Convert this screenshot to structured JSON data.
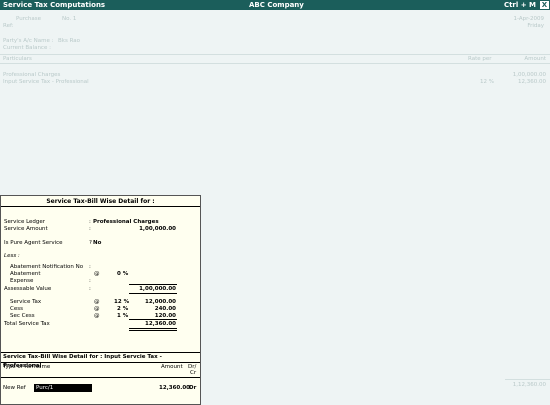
{
  "window": {
    "title": "Service Tax Computations",
    "company": "ABC Company",
    "shortcut": "Ctrl + M",
    "close_glyph": "X"
  },
  "background": {
    "voucher_type": "Purchase",
    "voucher_no": "No. 1",
    "date": "1-Apr-2009",
    "day": "Friday",
    "ref": "Ref:",
    "party_label": "Party's A/c Name :",
    "party_value": "Bks Rao",
    "balance_label": "Current Balance :",
    "col_particulars": "Particulars",
    "col_rate": "Rate  per",
    "col_amount": "Amount",
    "items": [
      {
        "name": "Professional Charges",
        "rate": "",
        "amount": "1,00,000.00"
      },
      {
        "name": "Input Service Tax - Professional",
        "rate": "12  %",
        "amount": "12,360.00"
      }
    ],
    "total": "1,12,360.00"
  },
  "popup": {
    "title": "Service Tax-Bill Wise Detail for :",
    "service_ledger_label": "Service Ledger",
    "service_ledger_value": "Professional Charges",
    "service_amount_label": "Service Amount",
    "service_amount_value": "1,00,000.00",
    "pure_agent_label": "Is Pure Agent Service",
    "pure_agent_q": "?",
    "pure_agent_value": "No",
    "less_label": "Less :",
    "abatement_notification_label": "Abatement Notification No",
    "abatement_label": "Abatement",
    "abatement_at": "@",
    "abatement_pct": "0  %",
    "expense_label": "Expense",
    "assessable_label": "Assessable Value",
    "assessable_value": "1,00,000.00",
    "service_tax_label": "Service Tax",
    "service_tax_at": "@",
    "service_tax_pct": "12  %",
    "service_tax_value": "12,000.00",
    "cess_label": "Cess",
    "cess_at": "@",
    "cess_pct": "2  %",
    "cess_value": "240.00",
    "sec_cess_label": "Sec Cess",
    "sec_cess_at": "@",
    "sec_cess_pct": "1  %",
    "sec_cess_value": "120.00",
    "total_label": "Total Service Tax",
    "total_value": "12,360.00",
    "colon": ":"
  },
  "billwise": {
    "title": "Service Tax-Bill Wise Detail for :  Input Servcie Tax - Professional",
    "col_type": "Type of Ref",
    "col_name": "Name",
    "col_amount": "Amount",
    "col_drcr_1": "Dr/",
    "col_drcr_2": "Cr",
    "new_ref_label": "New Ref",
    "new_ref_value": "Purc/1",
    "amount_value": "12,360.00",
    "drcr_value": "Dr"
  }
}
